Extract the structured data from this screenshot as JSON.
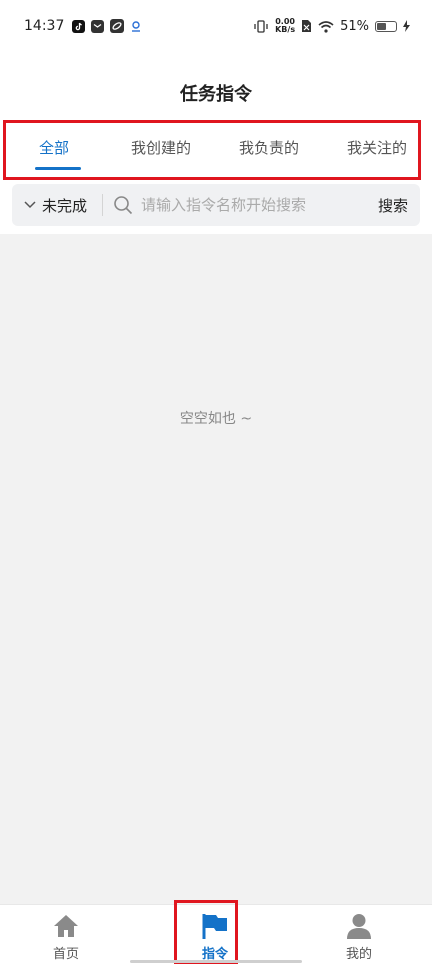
{
  "status_bar": {
    "time": "14:37",
    "net_speed_value": "0.00",
    "net_speed_unit": "KB/s",
    "battery_percent": "51%",
    "battery_level": 0.51
  },
  "header": {
    "title": "任务指令"
  },
  "tabs": [
    {
      "label": "全部",
      "active": true
    },
    {
      "label": "我创建的",
      "active": false
    },
    {
      "label": "我负责的",
      "active": false
    },
    {
      "label": "我关注的",
      "active": false
    }
  ],
  "filter": {
    "status_label": "未完成",
    "search_placeholder": "请输入指令名称开始搜索",
    "search_button": "搜索"
  },
  "content": {
    "empty_text": "空空如也 ~"
  },
  "bottom_nav": [
    {
      "label": "首页",
      "icon": "home-icon",
      "active": false
    },
    {
      "label": "指令",
      "icon": "flag-icon",
      "active": true
    },
    {
      "label": "我的",
      "icon": "person-icon",
      "active": false
    }
  ],
  "colors": {
    "accent": "#1472c8",
    "highlight_box": "#e0161f",
    "content_bg": "#f2f2f2"
  }
}
